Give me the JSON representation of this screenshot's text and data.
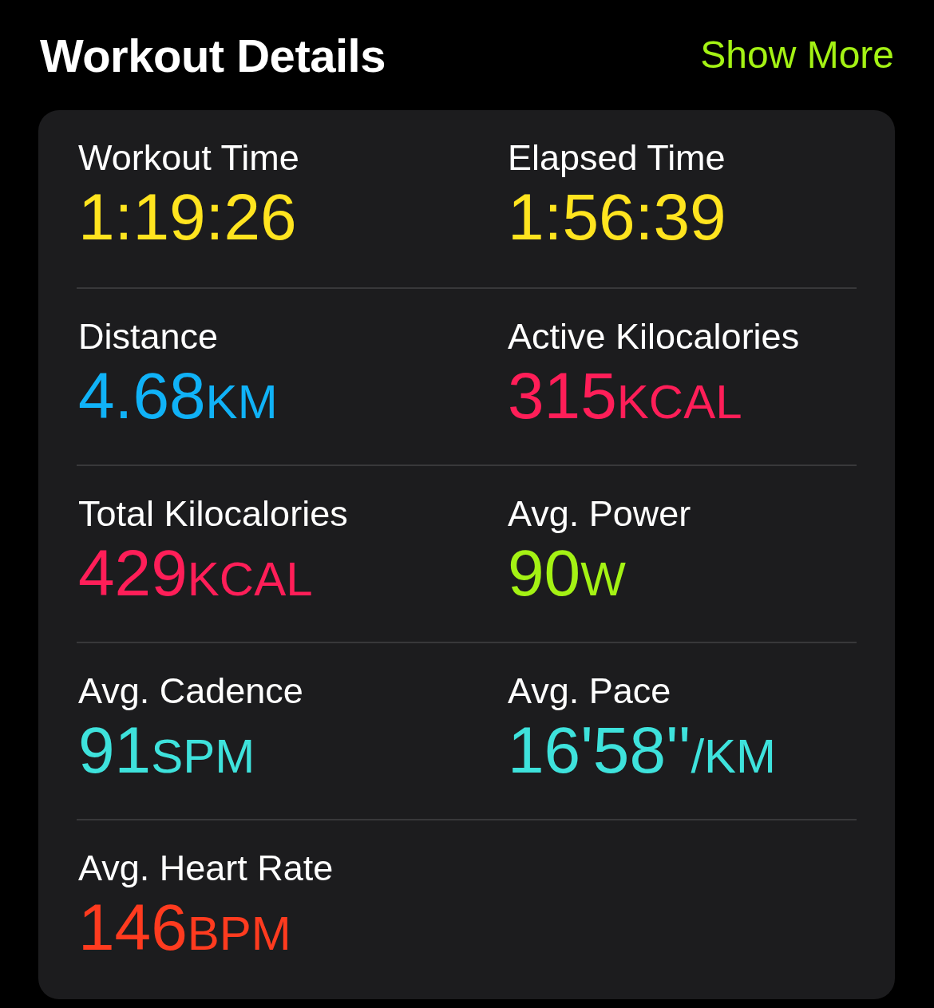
{
  "header": {
    "title": "Workout Details",
    "action": "Show More"
  },
  "metrics": [
    {
      "label": "Workout Time",
      "value": "1:19:26",
      "color": "#ffe41f"
    },
    {
      "label": "Elapsed Time",
      "value": "1:56:39",
      "color": "#ffe41f"
    },
    {
      "label": "Distance",
      "value": "4.68",
      "unit": "KM",
      "color": "#10b2f7"
    },
    {
      "label": "Active Kilocalories",
      "value": "315",
      "unit": "KCAL",
      "color": "#ff1e58"
    },
    {
      "label": "Total Kilocalories",
      "value": "429",
      "unit": "KCAL",
      "color": "#ff1e58"
    },
    {
      "label": "Avg. Power",
      "value": "90",
      "unit": "W",
      "color": "#a4f214"
    },
    {
      "label": "Avg. Cadence",
      "value": "91",
      "unit": "SPM",
      "color": "#3ee2dc"
    },
    {
      "label": "Avg. Pace",
      "value": "16'58''",
      "unit": "/KM",
      "color": "#3ee2dc"
    },
    {
      "label": "Avg. Heart Rate",
      "value": "146",
      "unit": "BPM",
      "color": "#ff3b1f"
    }
  ]
}
